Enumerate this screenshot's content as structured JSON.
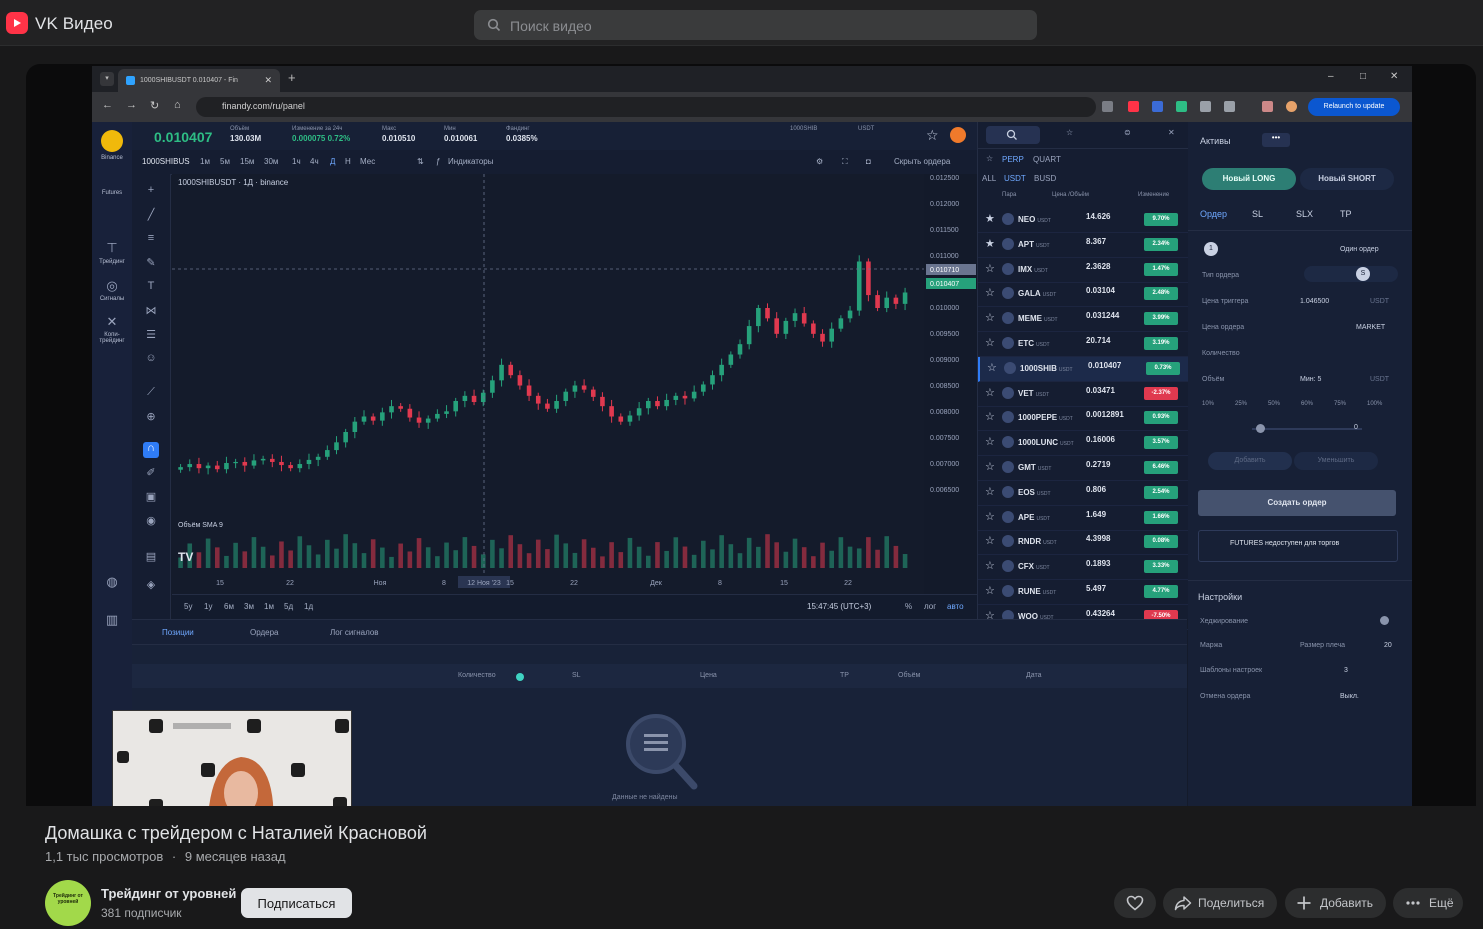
{
  "site": {
    "brand": "VK Видео",
    "search_placeholder": "Поиск видео"
  },
  "video": {
    "title": "Домашка с трейдером с Наталией Красновой",
    "views": "1,1 тыс просмотров",
    "age": "9 месяцев назад"
  },
  "channel": {
    "name": "Трейдинг от уровней",
    "subscribers": "381 подписчик",
    "avatar_text": "Трейдинг от уровней",
    "subscribe_label": "Подписаться"
  },
  "actions": {
    "share": "Поделиться",
    "add": "Добавить",
    "more": "Ещё"
  },
  "screen": {
    "tab_title": "1000SHIBUSDT 0.010407 - Fin",
    "url": "finandy.com/ru/panel",
    "relaunch": "Relaunch to update",
    "exchange": "Binance",
    "market_type": "Futures",
    "ticker": {
      "price": "0.010407",
      "stats": [
        {
          "label": "Объём",
          "value": "130.03M"
        },
        {
          "label": "Изменение за 24ч",
          "value": "0.000075  0.72%"
        },
        {
          "label": "Макс",
          "value": "0.010510"
        },
        {
          "label": "Мин",
          "value": "0.010061"
        },
        {
          "label": "Фандинг",
          "value": "0.0385%"
        }
      ],
      "pair_right": "1000SHIB",
      "quote_right": "USDT"
    },
    "toolbar": {
      "symbol": "1000SHIBUS",
      "timeframes": [
        "1м",
        "5м",
        "15м",
        "30м",
        "1ч",
        "4ч",
        "Д",
        "Н",
        "Мес"
      ],
      "indicators": "Индикаторы",
      "hide_orders": "Скрыть ордера"
    },
    "chart_legend": "1000SHIBUSDT · 1Д · binance",
    "volume_label": "Объём SMA 9",
    "left_labels": {
      "trading": "Трейдинг",
      "signals": "Сигналы",
      "copy": "Копи-трейдинг"
    },
    "time_axis": [
      "15",
      "22",
      "Ноя",
      "8",
      "12 Ноя '23",
      "15",
      "22",
      "Дек",
      "8",
      "15",
      "22"
    ],
    "price_axis": [
      "0.012500",
      "0.012000",
      "0.011500",
      "0.011000",
      "0.010500",
      "0.010000",
      "0.009500",
      "0.009000",
      "0.008500",
      "0.008000",
      "0.007500",
      "0.007000",
      "0.006500"
    ],
    "price_tag": "0.010710",
    "price_tag2": "0.010407",
    "ranges": [
      "5y",
      "1y",
      "6м",
      "3м",
      "1м",
      "5д",
      "1д"
    ],
    "clock": "15:47:45 (UTC+3)",
    "scale_opts": [
      "%",
      "лог",
      "авто"
    ],
    "market_filters": {
      "row1": [
        "PERP",
        "QUART"
      ],
      "row2": [
        "ALL",
        "USDT",
        "BUSD"
      ]
    },
    "market_cols": {
      "pair": "Пара",
      "price": "Цена /Объём",
      "change": "Изменение"
    },
    "markets": [
      {
        "sym": "NEO",
        "price": "14.626",
        "chg": "9.70%",
        "dir": "up"
      },
      {
        "sym": "APT",
        "price": "8.367",
        "chg": "2.34%",
        "dir": "up"
      },
      {
        "sym": "IMX",
        "price": "2.3628",
        "chg": "1.47%",
        "dir": "up"
      },
      {
        "sym": "GALA",
        "price": "0.03104",
        "chg": "2.48%",
        "dir": "up"
      },
      {
        "sym": "MEME",
        "price": "0.031244",
        "chg": "3.99%",
        "dir": "up"
      },
      {
        "sym": "ETC",
        "price": "20.714",
        "chg": "3.19%",
        "dir": "up"
      },
      {
        "sym": "1000SHIB",
        "price": "0.010407",
        "chg": "0.73%",
        "dir": "up"
      },
      {
        "sym": "VET",
        "price": "0.03471",
        "chg": "-2.37%",
        "dir": "dn"
      },
      {
        "sym": "1000PEPE",
        "price": "0.0012891",
        "chg": "0.93%",
        "dir": "up"
      },
      {
        "sym": "1000LUNC",
        "price": "0.16006",
        "chg": "3.57%",
        "dir": "up"
      },
      {
        "sym": "GMT",
        "price": "0.2719",
        "chg": "6.46%",
        "dir": "up"
      },
      {
        "sym": "EOS",
        "price": "0.806",
        "chg": "2.54%",
        "dir": "up"
      },
      {
        "sym": "APE",
        "price": "1.649",
        "chg": "1.66%",
        "dir": "up"
      },
      {
        "sym": "RNDR",
        "price": "4.3998",
        "chg": "0.08%",
        "dir": "up"
      },
      {
        "sym": "CFX",
        "price": "0.1893",
        "chg": "3.33%",
        "dir": "up"
      },
      {
        "sym": "RUNE",
        "price": "5.497",
        "chg": "4.77%",
        "dir": "up"
      },
      {
        "sym": "WOO",
        "price": "0.43264",
        "chg": "-7.50%",
        "dir": "dn"
      }
    ],
    "order": {
      "assets": "Активы",
      "long": "Новый LONG",
      "short": "Новый SHORT",
      "tabs": [
        "Ордер",
        "SL",
        "SLX",
        "TP"
      ],
      "one_order": "Один ордер",
      "order_type": "Тип ордера",
      "trigger_price": "Цена триггера",
      "trigger_value": "1.046500",
      "usdt": "USDT",
      "order_price": "Цена ордера",
      "market": "MARKET",
      "quantity": "Количество",
      "volume": "Объём",
      "min": "Мин: 5",
      "percents": [
        "10%",
        "25%",
        "50%",
        "60%",
        "75%",
        "100%"
      ],
      "slider_val": "0",
      "add": "Добавить",
      "reduce": "Уменьшить",
      "create": "Создать ордер",
      "futures_note": "FUTURES недоступен для торгов",
      "settings": "Настройки",
      "hedging": "Хеджирование",
      "margin": "Маржа",
      "leverage": "Размер плеча",
      "leverage_val": "20",
      "templates": "Шаблоны настроек",
      "templates_val": "3",
      "cancel_order": "Отмена ордера",
      "cancel_val": "Выкл."
    },
    "bottom": {
      "tabs": [
        "Позиции",
        "Ордера",
        "Лог сигналов"
      ],
      "cols": [
        "Количество",
        "SL",
        "Цена",
        "TP",
        "Объём",
        "Дата"
      ],
      "empty": "Данные не найдены"
    }
  },
  "colors": {
    "up": "#26a17b",
    "down": "#e0394f",
    "accent": "#2f7cf6",
    "vk_red": "#ff3347"
  },
  "chart_data": {
    "type": "candlestick",
    "symbol": "1000SHIBUSDT",
    "interval": "1Д",
    "ylim": [
      0.0065,
      0.0125
    ],
    "x_ticks": [
      "15",
      "22",
      "Ноя",
      "8",
      "12 Ноя '23",
      "15",
      "22",
      "Дек",
      "8",
      "15",
      "22"
    ],
    "close": [
      0.00702,
      0.00708,
      0.007,
      0.00705,
      0.00698,
      0.0071,
      0.00712,
      0.00705,
      0.00715,
      0.00718,
      0.00712,
      0.00706,
      0.007,
      0.00708,
      0.00716,
      0.00722,
      0.00735,
      0.0075,
      0.0077,
      0.0079,
      0.008,
      0.00792,
      0.00808,
      0.0082,
      0.00815,
      0.00798,
      0.00788,
      0.00796,
      0.00805,
      0.0081,
      0.0083,
      0.0084,
      0.00828,
      0.00846,
      0.0087,
      0.009,
      0.0088,
      0.0086,
      0.0084,
      0.00825,
      0.00815,
      0.0083,
      0.00848,
      0.0086,
      0.00852,
      0.00838,
      0.0082,
      0.008,
      0.0079,
      0.00802,
      0.00816,
      0.0083,
      0.0082,
      0.00832,
      0.0084,
      0.00835,
      0.00848,
      0.00862,
      0.0088,
      0.009,
      0.0092,
      0.0094,
      0.00975,
      0.0101,
      0.0099,
      0.0096,
      0.00985,
      0.01,
      0.0098,
      0.0096,
      0.00945,
      0.0097,
      0.0099,
      0.01005,
      0.011,
      0.01035,
      0.0101,
      0.0103,
      0.01018,
      0.0104
    ]
  }
}
